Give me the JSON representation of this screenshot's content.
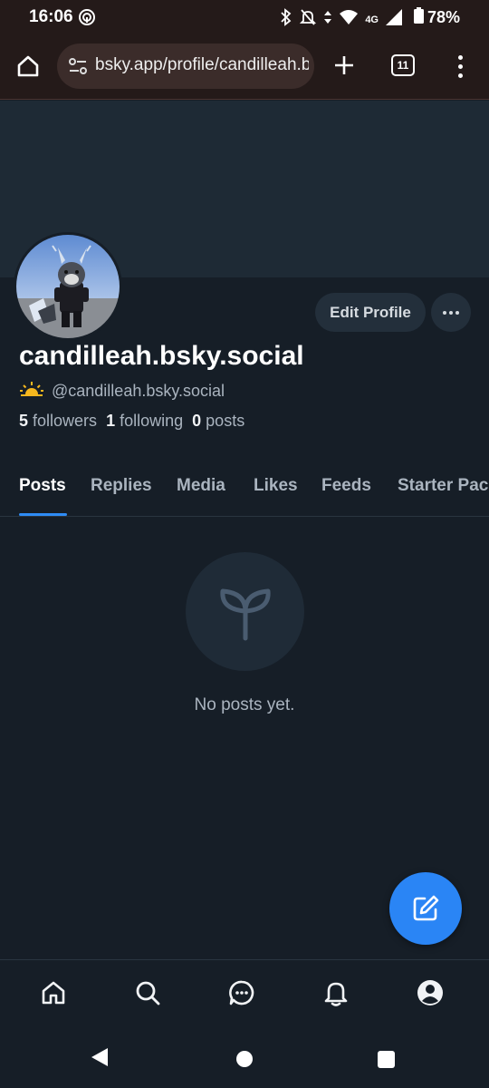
{
  "status_bar": {
    "time": "16:06",
    "network": "4G",
    "battery": "78%",
    "icons": [
      "hotspot-icon",
      "bluetooth-icon",
      "notifications-off-icon",
      "data-arrows-icon",
      "wifi-icon",
      "signal-icon",
      "battery-icon"
    ]
  },
  "browser": {
    "url": "bsky.app/profile/candilleah.bsky.social",
    "tab_count": "11"
  },
  "profile": {
    "display_name": "candilleah.bsky.social",
    "handle": "@candilleah.bsky.social",
    "edit_profile_label": "Edit Profile",
    "followers_count": "5",
    "followers_label": "followers",
    "following_count": "1",
    "following_label": "following",
    "posts_count": "0",
    "posts_label": "posts"
  },
  "tabs": [
    "Posts",
    "Replies",
    "Media",
    "Likes",
    "Feeds",
    "Starter Packs"
  ],
  "active_tab": "Posts",
  "empty_state": {
    "message": "No posts yet."
  },
  "bottom_nav": [
    "home-icon",
    "search-icon",
    "chat-icon",
    "notifications-icon",
    "profile-icon"
  ],
  "colors": {
    "accent": "#2a85f5",
    "background": "#161e27",
    "banner": "#1e2a35"
  }
}
